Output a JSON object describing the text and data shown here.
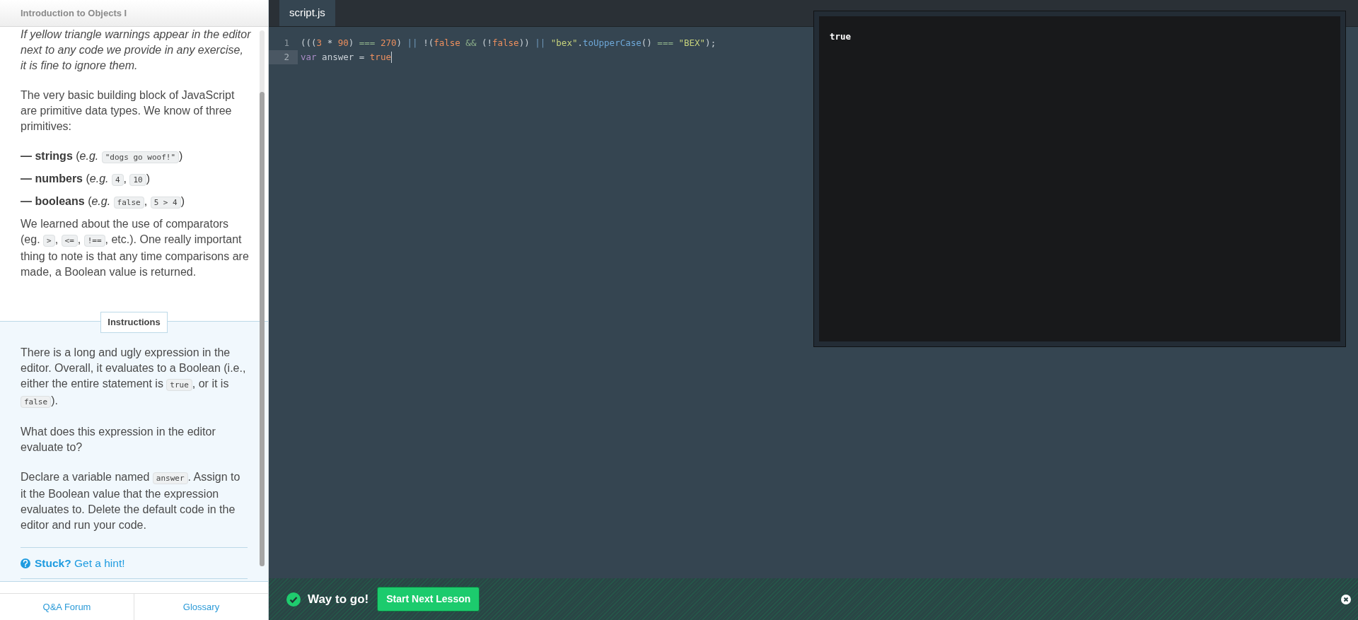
{
  "lesson_title": "Introduction to Objects I",
  "lesson_paragraphs": [
    {
      "kind": "note",
      "segments": [
        {
          "kind": "text",
          "s": "If yellow triangle warnings appear in the editor next to any code we provide in any exercise, it is fine to ignore them."
        }
      ]
    },
    {
      "kind": "text",
      "segments": [
        {
          "kind": "text",
          "s": "The very basic building block of JavaScript are primitive data types. We know of three primitives:"
        }
      ]
    },
    {
      "kind": "bullet",
      "segments": [
        {
          "kind": "text",
          "s": "**— strings** (*e.g.* "
        },
        {
          "kind": "code",
          "s": "\"dogs go woof!\""
        },
        {
          "kind": "text",
          "s": ")"
        }
      ]
    },
    {
      "kind": "bullet",
      "segments": [
        {
          "kind": "text",
          "s": "**— numbers** (*e.g.* "
        },
        {
          "kind": "code",
          "s": "4"
        },
        {
          "kind": "text",
          "s": ", "
        },
        {
          "kind": "code",
          "s": "10"
        },
        {
          "kind": "text",
          "s": ")"
        }
      ]
    },
    {
      "kind": "bullet",
      "segments": [
        {
          "kind": "text",
          "s": "**— booleans** (*e.g.* "
        },
        {
          "kind": "code",
          "s": "false"
        },
        {
          "kind": "text",
          "s": ", "
        },
        {
          "kind": "code",
          "s": "5 > 4"
        },
        {
          "kind": "text",
          "s": ")"
        }
      ]
    },
    {
      "kind": "text",
      "segments": [
        {
          "kind": "text",
          "s": "We learned about the use of comparators (eg. "
        },
        {
          "kind": "code",
          "s": ">"
        },
        {
          "kind": "text",
          "s": ", "
        },
        {
          "kind": "code",
          "s": "<="
        },
        {
          "kind": "text",
          "s": ", "
        },
        {
          "kind": "code",
          "s": "!=="
        },
        {
          "kind": "text",
          "s": ", etc.). One really important thing to note is that any time comparisons are made, a Boolean value is returned."
        }
      ]
    }
  ],
  "instructions": {
    "label": "Instructions",
    "paragraphs": [
      {
        "kind": "text",
        "segments": [
          {
            "kind": "text",
            "s": "There is a long and ugly expression in the editor. Overall, it evaluates to a Boolean (i.e., either the entire statement is "
          },
          {
            "kind": "code",
            "s": "true"
          },
          {
            "kind": "text",
            "s": ", or it is "
          },
          {
            "kind": "code",
            "s": "false"
          },
          {
            "kind": "text",
            "s": ")."
          }
        ]
      },
      {
        "kind": "text",
        "segments": [
          {
            "kind": "text",
            "s": "What does this expression in the editor evaluate to?"
          }
        ]
      },
      {
        "kind": "text",
        "segments": [
          {
            "kind": "text",
            "s": "Declare a variable named "
          },
          {
            "kind": "code",
            "s": "answer"
          },
          {
            "kind": "text",
            "s": ". Assign to it the Boolean value that the expression evaluates to. Delete the default code in the editor and run your code."
          }
        ]
      }
    ]
  },
  "hint": {
    "prefix": "Stuck?",
    "link": "Get a hint!"
  },
  "footer_links": [
    "Q&A Forum",
    "Glossary"
  ],
  "editor": {
    "tabs": [
      {
        "label": "script.js",
        "selected": true
      }
    ],
    "lines": [
      {
        "number": "1",
        "current": false,
        "tokens": [
          {
            "kind": "punct",
            "s": "((("
          },
          {
            "kind": "literal",
            "s": "3"
          },
          {
            "kind": "punct",
            "s": " * "
          },
          {
            "kind": "literal",
            "s": "90"
          },
          {
            "kind": "punct",
            "s": ") "
          },
          {
            "kind": "compare",
            "s": "=== "
          },
          {
            "kind": "literal",
            "s": "270"
          },
          {
            "kind": "punct",
            "s": ") "
          },
          {
            "kind": "logic",
            "s": "||"
          },
          {
            "kind": "punct",
            "s": " !("
          },
          {
            "kind": "literal",
            "s": "false"
          },
          {
            "kind": "compare",
            "s": " && "
          },
          {
            "kind": "punct",
            "s": "(!"
          },
          {
            "kind": "literal",
            "s": "false"
          },
          {
            "kind": "punct",
            "s": ")) "
          },
          {
            "kind": "logic",
            "s": "|| "
          },
          {
            "kind": "string",
            "s": "\"bex\""
          },
          {
            "kind": "punct",
            "s": "."
          },
          {
            "kind": "method",
            "s": "toUpperCase"
          },
          {
            "kind": "punct",
            "s": "() "
          },
          {
            "kind": "compare",
            "s": "=== "
          },
          {
            "kind": "string",
            "s": "\"BEX\""
          },
          {
            "kind": "punct",
            "s": ");"
          }
        ]
      },
      {
        "number": "2",
        "current": true,
        "tokens": [
          {
            "kind": "keyword",
            "s": "var"
          },
          {
            "kind": "punct",
            "s": " answer = "
          },
          {
            "kind": "literal",
            "s": "true"
          }
        ]
      }
    ]
  },
  "output": {
    "lines": [
      "true"
    ]
  },
  "success_bar": {
    "message": "Way to go!",
    "button": "Start Next Lesson"
  }
}
